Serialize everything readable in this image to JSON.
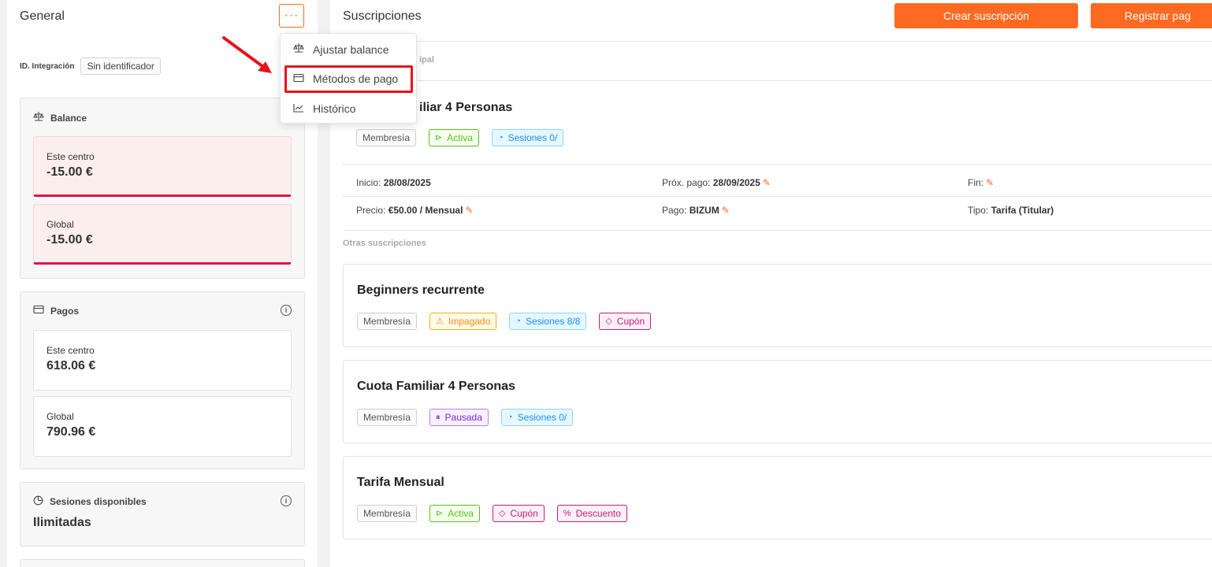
{
  "left": {
    "title": "General",
    "more_label": "···",
    "integration": {
      "label": "ID. Integración",
      "value": "Sin identificador"
    },
    "balance": {
      "title": "Balance",
      "center": {
        "label": "Este centro",
        "value": "-15.00 €"
      },
      "global": {
        "label": "Global",
        "value": "-15.00 €"
      }
    },
    "pagos": {
      "title": "Pagos",
      "center": {
        "label": "Este centro",
        "value": "618.06 €"
      },
      "global": {
        "label": "Global",
        "value": "790.96 €"
      }
    },
    "sesiones": {
      "title": "Sesiones disponibles",
      "value": "Ilimitadas"
    }
  },
  "dropdown": {
    "items": [
      {
        "label": "Ajustar balance",
        "icon": "scale-icon"
      },
      {
        "label": "Métodos de pago",
        "icon": "card-icon"
      },
      {
        "label": "Histórico",
        "icon": "chart-line-icon"
      }
    ]
  },
  "main": {
    "title": "Suscripciones",
    "create_btn": "Crear suscripción",
    "register_btn": "Registrar pag",
    "principal_label": "ipal",
    "other_label": "Otras suscripciones",
    "principal": {
      "name": "iliar 4 Personas",
      "tags": [
        "Membresía",
        "Activa",
        "Sesiones 0/"
      ],
      "details": {
        "inicio_label": "Inicio:",
        "inicio": "28/08/2025",
        "prox_label": "Próx. pago:",
        "prox": "28/09/2025",
        "fin_label": "Fin:",
        "precio_label": "Precio:",
        "precio": "€50.00 / Mensual",
        "pago_label": "Pago:",
        "pago": "BIZUM",
        "tipo_label": "Tipo:",
        "tipo": "Tarifa (Titular)"
      }
    },
    "others": [
      {
        "name": "Beginners recurrente",
        "tags": [
          "Membresía",
          "Impagado",
          "Sesiones 8/8",
          "Cupón"
        ]
      },
      {
        "name": "Cuota Familiar 4 Personas",
        "tags": [
          "Membresía",
          "Pausada",
          "Sesiones 0/"
        ]
      },
      {
        "name": "Tarifa Mensual",
        "tags": [
          "Membresía",
          "Activa",
          "Cupón",
          "Descuento"
        ]
      }
    ]
  },
  "colors": {
    "accent": "#ff6a22",
    "negative": "#d7184a",
    "highlight": "#e8131b"
  }
}
